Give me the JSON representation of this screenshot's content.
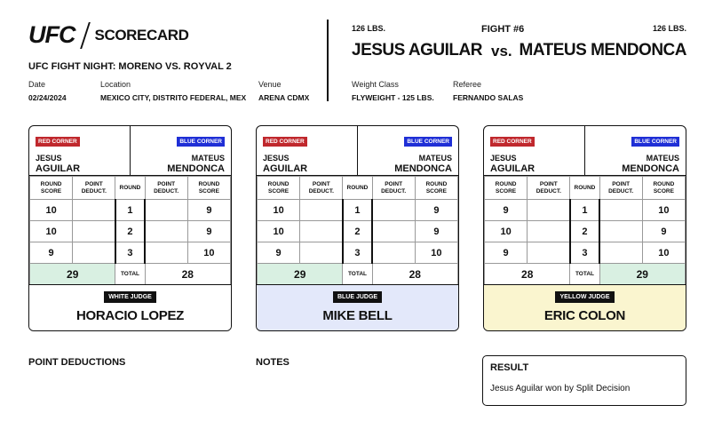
{
  "header": {
    "logo_text": "UFC",
    "title": "SCORECARD",
    "event_name": "UFC FIGHT NIGHT: MORENO VS. ROYVAL 2",
    "date_label": "Date",
    "date": "02/24/2024",
    "location_label": "Location",
    "location": "MEXICO CITY, DISTRITO FEDERAL, MEX",
    "venue_label": "Venue",
    "venue": "ARENA CDMX",
    "weight_class_label": "Weight Class",
    "weight_class": "FLYWEIGHT - 125 LBS.",
    "referee_label": "Referee",
    "referee": "FERNANDO SALAS"
  },
  "fight": {
    "number": "FIGHT #6",
    "vs": "vs.",
    "red_weight": "126 LBS.",
    "blue_weight": "126 LBS.",
    "red_fighter": "JESUS AGUILAR",
    "blue_fighter": "MATEUS MENDONCA"
  },
  "table_headers": {
    "round_score": "ROUND SCORE",
    "point_deduct": "POINT DEDUCT.",
    "round": "ROUND",
    "total": "TOTAL"
  },
  "cards": [
    {
      "red_badge": "RED CORNER",
      "blue_badge": "BLUE CORNER",
      "red_first": "JESUS",
      "red_last": "AGUILAR",
      "blue_first": "MATEUS",
      "blue_last": "MENDONCA",
      "rounds": [
        {
          "red": "10",
          "red_ded": "",
          "round": "1",
          "blue_ded": "",
          "blue": "9"
        },
        {
          "red": "10",
          "red_ded": "",
          "round": "2",
          "blue_ded": "",
          "blue": "9"
        },
        {
          "red": "9",
          "red_ded": "",
          "round": "3",
          "blue_ded": "",
          "blue": "10"
        }
      ],
      "red_total": "29",
      "blue_total": "28",
      "judge_badge": "WHITE JUDGE",
      "judge_name": "HORACIO LOPEZ",
      "judge_color": "#ffffff",
      "winner": "red"
    },
    {
      "red_badge": "RED CORNER",
      "blue_badge": "BLUE CORNER",
      "red_first": "JESUS",
      "red_last": "AGUILAR",
      "blue_first": "MATEUS",
      "blue_last": "MENDONCA",
      "rounds": [
        {
          "red": "10",
          "red_ded": "",
          "round": "1",
          "blue_ded": "",
          "blue": "9"
        },
        {
          "red": "10",
          "red_ded": "",
          "round": "2",
          "blue_ded": "",
          "blue": "9"
        },
        {
          "red": "9",
          "red_ded": "",
          "round": "3",
          "blue_ded": "",
          "blue": "10"
        }
      ],
      "red_total": "29",
      "blue_total": "28",
      "judge_badge": "BLUE JUDGE",
      "judge_name": "MIKE BELL",
      "judge_color": "#e3e8fa",
      "winner": "red"
    },
    {
      "red_badge": "RED CORNER",
      "blue_badge": "BLUE CORNER",
      "red_first": "JESUS",
      "red_last": "AGUILAR",
      "blue_first": "MATEUS",
      "blue_last": "MENDONCA",
      "rounds": [
        {
          "red": "9",
          "red_ded": "",
          "round": "1",
          "blue_ded": "",
          "blue": "10"
        },
        {
          "red": "10",
          "red_ded": "",
          "round": "2",
          "blue_ded": "",
          "blue": "9"
        },
        {
          "red": "9",
          "red_ded": "",
          "round": "3",
          "blue_ded": "",
          "blue": "10"
        }
      ],
      "red_total": "28",
      "blue_total": "29",
      "judge_badge": "YELLOW JUDGE",
      "judge_name": "ERIC COLON",
      "judge_color": "#faf5cf",
      "winner": "blue"
    }
  ],
  "bottom": {
    "point_deductions_title": "POINT DEDUCTIONS",
    "notes_title": "NOTES",
    "result_title": "RESULT",
    "result_text": "Jesus Aguilar won by Split Decision"
  },
  "colors": {
    "red_corner": "#c0282d",
    "blue_corner": "#1f2fd6",
    "winner_total_bg": "#d9f0e2"
  }
}
